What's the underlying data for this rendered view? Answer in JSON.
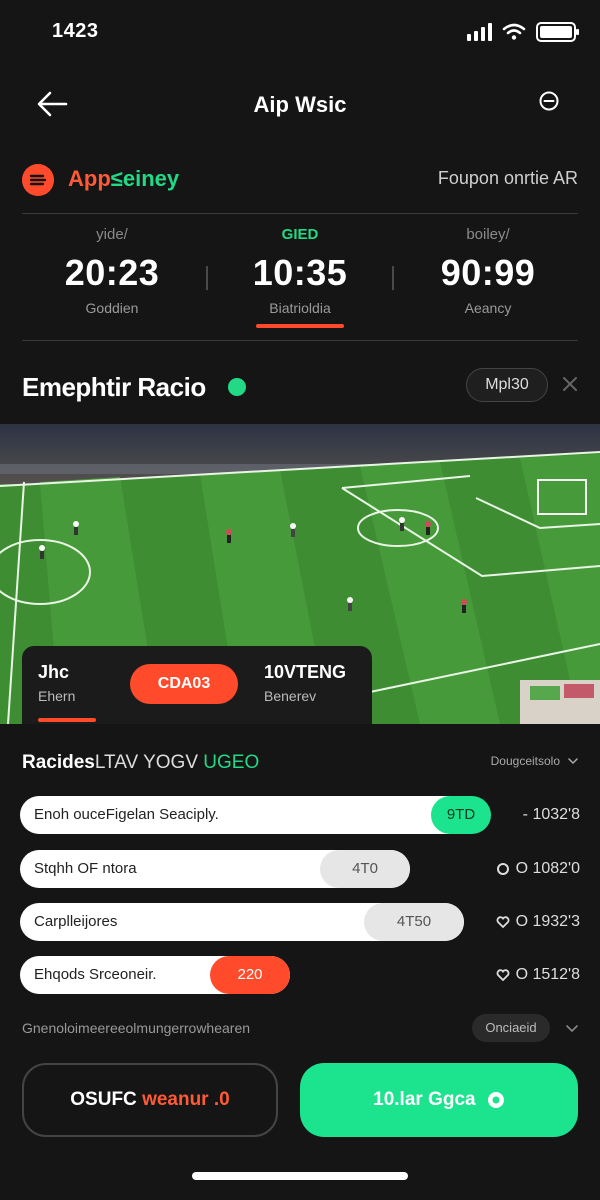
{
  "status_bar": {
    "time": "1423"
  },
  "nav": {
    "title": "Aip Wsic"
  },
  "brand": {
    "name_part1": "App",
    "name_part2": "≤einey",
    "right_text": "Foupon onrtie AR"
  },
  "stats": [
    {
      "top": "yide/",
      "value": "20:23",
      "sub": "Goddien",
      "active": false
    },
    {
      "top": "GIED",
      "value": "10:35",
      "sub": "Biatrioldia",
      "active": true
    },
    {
      "top": "boiley/",
      "value": "90:99",
      "sub": "Aeancy",
      "active": false
    }
  ],
  "section": {
    "title": "Emephtir Racio",
    "pill": "Mpl30"
  },
  "score": {
    "left_name": "Jhc",
    "left_sub": "Ehern",
    "score_label": "CDA03",
    "right_name": "10VTENG",
    "right_sub": "Benerev"
  },
  "list": {
    "title_main": "Racides",
    "title_mid": "LTAV  YOGV",
    "title_accent": "UGEO",
    "filter": "Dougceitsolo",
    "rows": [
      {
        "label": "Enoh ouceFigelan Seaciply.",
        "badge": "9TD",
        "value": "- 1032'8",
        "fill": 0.84,
        "badge_color": "#1be38e",
        "badge_text_color": "#0d3b24"
      },
      {
        "label": "Stqhh OF ntora",
        "badge": "4T0",
        "value": "O 1082'0",
        "fill": 0.7,
        "badge_color": "#e6e6e6",
        "badge_text_color": "#555555"
      },
      {
        "label": "Carplleijores",
        "badge": "4T50",
        "value": "O 1932'3",
        "fill": 0.79,
        "badge_color": "#e6e6e6",
        "badge_text_color": "#555555"
      },
      {
        "label": "Ehqods Srceoneir.",
        "badge": "220",
        "value": "O 1512'8",
        "fill": 0.48,
        "badge_color": "#ff4b2b",
        "badge_text_color": "#ffffff"
      }
    ]
  },
  "footer_hint": {
    "text": "Gnenoloimeereeolmungerrowhearen",
    "pill": "Onciaeid"
  },
  "cta": {
    "left_part1": "OSUFC",
    "left_part2": "weanur .0",
    "right": "10.lar Ggca"
  }
}
